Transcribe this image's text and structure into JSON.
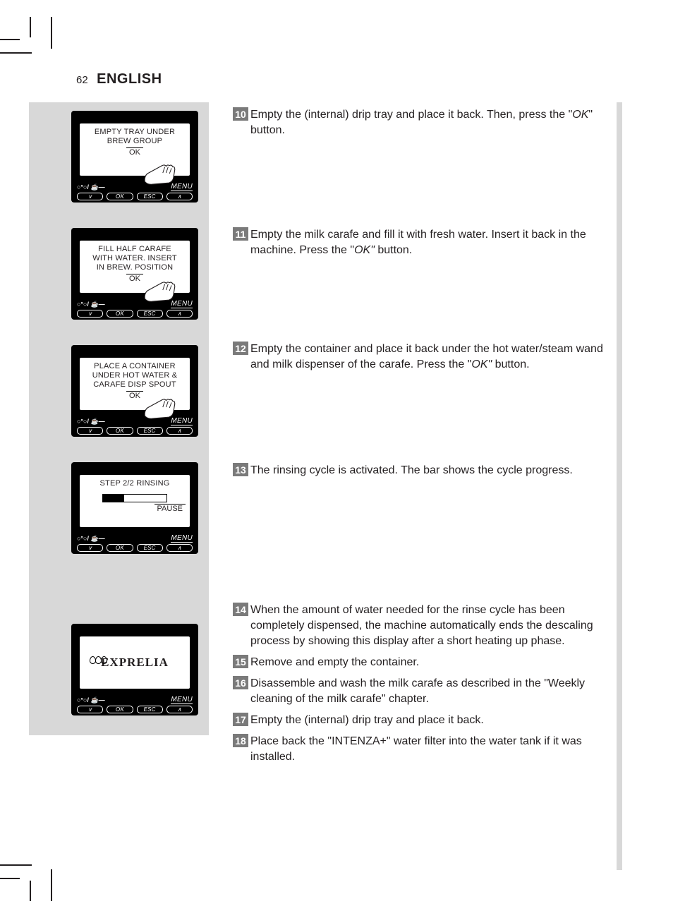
{
  "header": {
    "page_number": "62",
    "language": "ENGLISH"
  },
  "lcd_common": {
    "menu_label": "MENU",
    "intensity_label": "○°○/ ☕—",
    "btn_down": "∨",
    "btn_ok": "OK",
    "btn_esc": "ESC",
    "btn_up": "∧"
  },
  "screens": [
    {
      "lines": [
        "EMPTY TRAY UNDER",
        "BREW GROUP"
      ],
      "confirm": "OK",
      "hand": true
    },
    {
      "lines": [
        "FILL HALF CARAFE",
        "WITH WATER. INSERT",
        "IN BREW. POSITION"
      ],
      "confirm": "OK",
      "hand": true
    },
    {
      "lines": [
        "PLACE A CONTAINER",
        "UNDER HOT WATER &",
        "CARAFE DISP SPOUT"
      ],
      "confirm": "OK",
      "hand": true
    },
    {
      "lines": [
        "STEP 2/2 RINSING"
      ],
      "progress": true,
      "pause": "PAUSE"
    },
    {
      "logo": "EXPRELIA",
      "beans": true
    }
  ],
  "steps": [
    {
      "n": "10",
      "pre": "Empty the (internal) drip tray and place it back. Then, press the \"",
      "it": "OK",
      "post": "\" button."
    },
    {
      "n": "11",
      "pre": "Empty the milk carafe and fill it with fresh water. Insert it back in the machine. Press the \"",
      "it": "OK\"",
      "post": " button."
    },
    {
      "n": "12",
      "pre": "Empty the container and place it back under the hot water/steam wand and milk dispenser of the carafe. Press the \"",
      "it": "OK\"",
      "post": " button."
    },
    {
      "n": "13",
      "pre": "The rinsing cycle is activated. The bar shows the cycle progress.",
      "it": "",
      "post": ""
    },
    {
      "n": "14",
      "pre": "When the amount of water needed for the rinse cycle has been completely dispensed, the machine automatically ends the descaling process by showing this display after a short heating up phase.",
      "it": "",
      "post": ""
    },
    {
      "n": "15",
      "pre": "Remove and empty the container.",
      "it": "",
      "post": ""
    },
    {
      "n": "16",
      "pre": "Disassemble and wash the milk carafe as described in the \"Weekly cleaning of the milk carafe\" chapter.",
      "it": "",
      "post": ""
    },
    {
      "n": "17",
      "pre": "Empty the (internal) drip tray and place it back.",
      "it": "",
      "post": ""
    },
    {
      "n": "18",
      "pre": "Place back the \"INTENZA+\" water filter into the water tank if it was installed.",
      "it": "",
      "post": ""
    }
  ]
}
